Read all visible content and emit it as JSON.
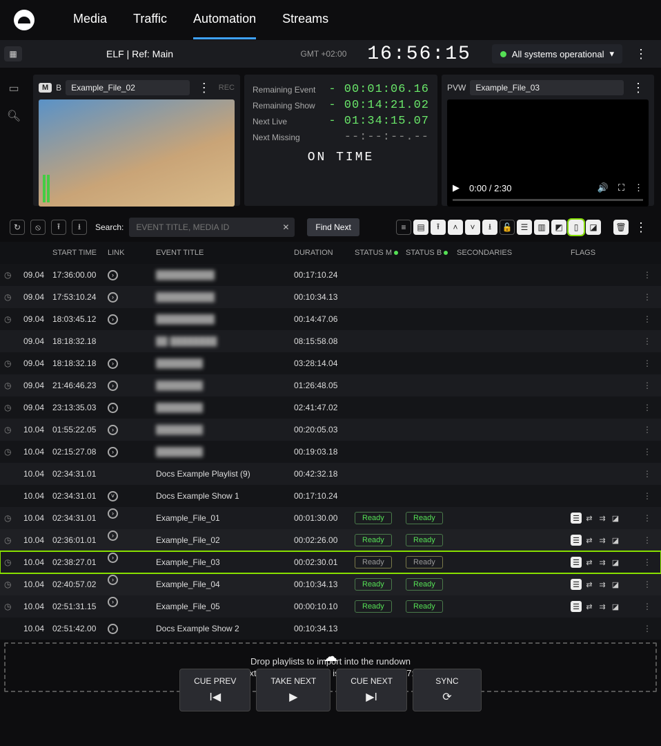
{
  "nav": {
    "items": [
      "Media",
      "Traffic",
      "Automation",
      "Streams"
    ],
    "active": 2
  },
  "status": {
    "channel": "ELF | Ref: Main",
    "tz": "GMT +02:00",
    "clock": "16:56:15",
    "system": "All systems operational"
  },
  "live": {
    "badge_m": "M",
    "badge_b": "B",
    "filename": "Example_File_02",
    "rec": "REC"
  },
  "timers": {
    "remaining_event_lbl": "Remaining Event",
    "remaining_event": "- 00:01:06.16",
    "remaining_show_lbl": "Remaining Show",
    "remaining_show": "- 00:14:21.02",
    "next_live_lbl": "Next Live",
    "next_live": "- 01:34:15.07",
    "next_missing_lbl": "Next Missing",
    "next_missing": "--:--:--.--",
    "ontime": "ON TIME"
  },
  "pvw": {
    "label": "PVW",
    "filename": "Example_File_03",
    "time": "0:00 / 2:30"
  },
  "search": {
    "label": "Search:",
    "placeholder": "EVENT TITLE, MEDIA ID",
    "find_next": "Find Next"
  },
  "columns": {
    "start": "START TIME",
    "link": "LINK",
    "title": "EVENT TITLE",
    "duration": "DURATION",
    "status_m": "STATUS M",
    "status_b": "STATUS B",
    "secondaries": "SECONDARIES",
    "flags": "FLAGS"
  },
  "rows": [
    {
      "clk": true,
      "date": "09.04",
      "time": "17:36:00.00",
      "link": true,
      "title": "██████████",
      "blur": true,
      "dur": "00:17:10.24",
      "menu": true
    },
    {
      "clk": true,
      "date": "09.04",
      "time": "17:53:10.24",
      "link": true,
      "title": "██████████",
      "blur": true,
      "dur": "00:10:34.13",
      "menu": true
    },
    {
      "clk": true,
      "date": "09.04",
      "time": "18:03:45.12",
      "link": true,
      "title": "██████████",
      "blur": true,
      "dur": "00:14:47.06",
      "menu": true
    },
    {
      "clk": false,
      "date": "09.04",
      "time": "18:18:32.18",
      "link": false,
      "title": "██ ████████",
      "blur": true,
      "dur": "08:15:58.08",
      "menu": true
    },
    {
      "clk": true,
      "date": "09.04",
      "time": "18:18:32.18",
      "link": true,
      "title": "████████",
      "blur": true,
      "dur": "03:28:14.04",
      "menu": true
    },
    {
      "clk": true,
      "date": "09.04",
      "time": "21:46:46.23",
      "link": true,
      "title": "████████",
      "blur": true,
      "dur": "01:26:48.05",
      "menu": true
    },
    {
      "clk": true,
      "date": "09.04",
      "time": "23:13:35.03",
      "link": true,
      "title": "████████",
      "blur": true,
      "dur": "02:41:47.02",
      "menu": true
    },
    {
      "clk": true,
      "date": "10.04",
      "time": "01:55:22.05",
      "link": true,
      "title": "████████",
      "blur": true,
      "dur": "00:20:05.03",
      "menu": true
    },
    {
      "clk": true,
      "date": "10.04",
      "time": "02:15:27.08",
      "link": true,
      "title": "████████",
      "blur": true,
      "dur": "00:19:03.18",
      "menu": true
    },
    {
      "clk": false,
      "date": "10.04",
      "time": "02:34:31.01",
      "link": false,
      "title": "Docs Example Playlist (9)",
      "dur": "00:42:32.18",
      "menu": true
    },
    {
      "clk": false,
      "date": "10.04",
      "time": "02:34:31.01",
      "link": true,
      "linkdown": true,
      "title": "Docs Example Show 1",
      "dur": "00:17:10.24",
      "menu": true
    },
    {
      "clk": true,
      "date": "10.04",
      "time": "02:34:31.01",
      "link": true,
      "thumb": true,
      "title": "Example_File_01",
      "dur": "00:01:30.00",
      "sm": "Ready",
      "sb": "Ready",
      "flags": true,
      "menu": true,
      "sub": true
    },
    {
      "clk": true,
      "date": "10.04",
      "time": "02:36:01.01",
      "link": true,
      "thumb": true,
      "title": "Example_File_02",
      "dur": "00:02:26.00",
      "sm": "Ready",
      "sb": "Ready",
      "flags": true,
      "menu": true,
      "sub": true
    },
    {
      "clk": true,
      "date": "10.04",
      "time": "02:38:27.01",
      "link": true,
      "thumb": true,
      "title": "Example_File_03",
      "dur": "00:02:30.01",
      "sm": "Ready",
      "sb": "Ready",
      "flags": true,
      "menu": true,
      "sub": true,
      "hl": true
    },
    {
      "clk": true,
      "date": "10.04",
      "time": "02:40:57.02",
      "link": true,
      "thumb": true,
      "title": "Example_File_04",
      "dur": "00:10:34.13",
      "sm": "Ready",
      "sb": "Ready",
      "flags": true,
      "menu": true,
      "sub": true
    },
    {
      "clk": true,
      "date": "10.04",
      "time": "02:51:31.15",
      "link": true,
      "thumb": true,
      "title": "Example_File_05",
      "dur": "00:00:10.10",
      "sm": "Ready",
      "sb": "Ready",
      "flags": true,
      "menu": true,
      "sub": true
    },
    {
      "clk": false,
      "date": "10.04",
      "time": "02:51:42.00",
      "link": true,
      "title": "Docs Example Show 2",
      "dur": "00:10:34.13",
      "menu": true
    }
  ],
  "ready_label": "Ready",
  "drop": {
    "line1": "Drop playlists to import into the rundown",
    "line2": "the next available time slot is 10.04.2024 03:17:03.19"
  },
  "footer": {
    "cue_prev": "CUE PREV",
    "take_next": "TAKE NEXT",
    "cue_next": "CUE NEXT",
    "sync": "SYNC"
  }
}
